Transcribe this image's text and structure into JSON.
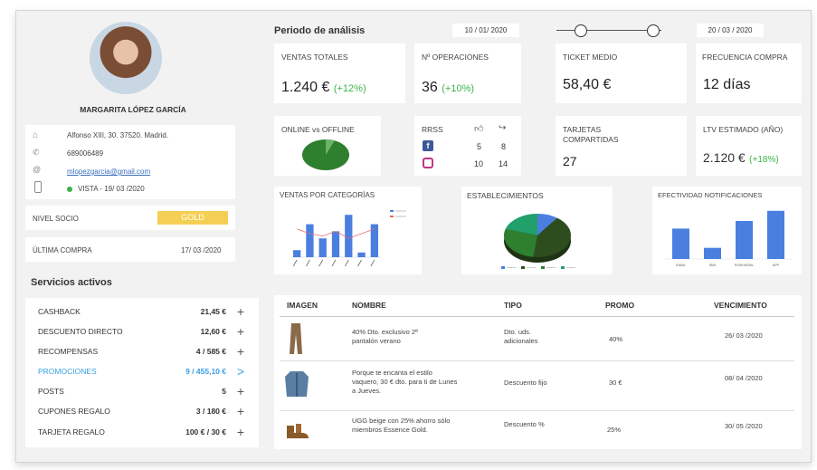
{
  "profile": {
    "name": "MARGARITA LÓPEZ GARCÍA",
    "address": "Alfonso XIII, 30. 37520. Madrid.",
    "phone": "689006489",
    "email": "mlopezgarcia@gmail.com",
    "last_visit": "VISTA - 19/ 03 /2020",
    "level_label": "NIVEL SOCIO",
    "level_value": "GOLD",
    "last_purchase_label": "ÚLTIMA COMPRA",
    "last_purchase_value": "17/ 03 /2020",
    "colors": {
      "gold": "#f5cf54",
      "online_dot": "#3bb54a"
    }
  },
  "services": {
    "title": "Servicios activos",
    "items": [
      {
        "label": "CASHBACK",
        "value": "21,45 €",
        "action": "+"
      },
      {
        "label": "DESCUENTO DIRECTO",
        "value": "12,60 €",
        "action": "+"
      },
      {
        "label": "RECOMPENSAS",
        "value": "4 / 585 €",
        "action": "+"
      },
      {
        "label": "PROMOCIONES",
        "value": "9 / 455,10 €",
        "action": ">"
      },
      {
        "label": "POSTS",
        "value": "5",
        "action": "+"
      },
      {
        "label": "CUPONES REGALO",
        "value": "3 / 180 €",
        "action": "+"
      },
      {
        "label": "TARJETA REGALO",
        "value": "100 € / 30 €",
        "action": "+"
      }
    ],
    "active_color": "#3aa0e6"
  },
  "period": {
    "title": "Periodo de análisis",
    "start": "10 / 01/ 2020",
    "end": "20 / 03 / 2020"
  },
  "kpis": {
    "ventas": {
      "label": "VENTAS TOTALES",
      "value": "1.240 €",
      "delta": "(+12%)"
    },
    "operaciones": {
      "label": "Nº OPERACIONES",
      "value": "36",
      "delta": "(+10%)"
    },
    "ticket": {
      "label": "TICKET MEDIO",
      "value": "58,40 €"
    },
    "frecuencia": {
      "label": "FRECUENCIA COMPRA",
      "value": "12 días"
    },
    "online": {
      "label": "ONLINE vs OFFLINE"
    },
    "rrss": {
      "label": "RRSS",
      "facebook": {
        "a": "5",
        "b": "8"
      },
      "instagram": {
        "a": "10",
        "b": "14"
      }
    },
    "tarjetas": {
      "label": "TARJETAS COMPARTIDAS",
      "value": "27"
    },
    "ltv": {
      "label": "LTV ESTIMADO (AÑO)",
      "value": "2.120 €",
      "delta": "(+18%)"
    }
  },
  "charts": {
    "categorias": {
      "label": "VENTAS POR CATEGORÍAS"
    },
    "establecimientos": {
      "label": "ESTABLECIMIENTOS"
    },
    "efectividad": {
      "label": "EFECTIVIDAD NOTIFICACIONES"
    }
  },
  "chart_data": [
    {
      "type": "bar",
      "title": "VENTAS POR CATEGORÍAS",
      "categories": [
        "1",
        "2",
        "3",
        "4",
        "5",
        "6",
        "7"
      ],
      "series": [
        {
          "values": [
            3,
            14,
            8,
            11,
            18,
            2,
            14
          ]
        },
        {
          "values": [
            12,
            10,
            9,
            11,
            8,
            10,
            12
          ]
        }
      ],
      "colors": [
        "#4a7fe0",
        "#e86a6a"
      ]
    },
    {
      "type": "pie",
      "title": "ESTABLECIMIENTOS",
      "values": [
        10,
        42,
        28,
        20
      ],
      "colors": [
        "#4a7fe0",
        "#2e4d1f",
        "#2e7f2e",
        "#22a06b"
      ]
    },
    {
      "type": "bar",
      "title": "EFECTIVIDAD NOTIFICACIONES",
      "categories": [
        "EMAIL",
        "SMS",
        "PUSH MÓVIL",
        "APP"
      ],
      "values": [
        60,
        22,
        75,
        95
      ],
      "color": "#4a7fe0"
    }
  ],
  "promos": {
    "headers": [
      "IMAGEN",
      "NOMBRE",
      "TIPO",
      "PROMO",
      "VENCIMIENTO"
    ],
    "rows": [
      {
        "name": "40% Dto. exclusivo 2ª pantalón verano",
        "type": "Dto. uds. adicionales",
        "promo": "40%",
        "expiry": "26/ 03 /2020"
      },
      {
        "name": "Porque te encanta el estilo vaquero, 30 € dto. para ti de Lunes a Jueves.",
        "type": "Descuento fijo",
        "promo": "30 €",
        "expiry": "08/ 04 /2020"
      },
      {
        "name": "UGG beige con 25% ahorro sólo miembros Essence Gold.",
        "type": "Descuento %",
        "promo": "25%",
        "expiry": "30/ 05 /2020"
      }
    ]
  }
}
